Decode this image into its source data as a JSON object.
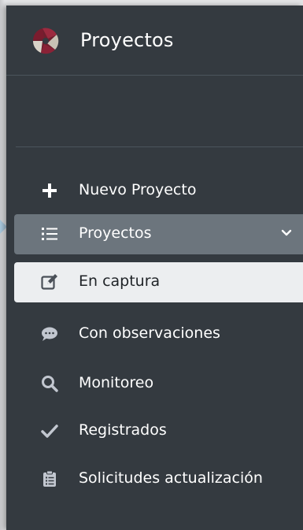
{
  "brand": {
    "title": "Proyectos",
    "logo_icon": "camera-shutter-logo"
  },
  "nav": {
    "items": [
      {
        "label": "Nuevo Proyecto",
        "icon": "plus-icon"
      },
      {
        "label": "Proyectos",
        "icon": "list-icon",
        "expanded": true
      },
      {
        "label": "En captura",
        "icon": "edit-icon",
        "active": true
      },
      {
        "label": "Con observaciones",
        "icon": "comment-icon"
      },
      {
        "label": "Monitoreo",
        "icon": "search-icon"
      },
      {
        "label": "Registrados",
        "icon": "check-icon"
      },
      {
        "label": "Solicitudes actualización",
        "icon": "clipboard-icon"
      }
    ]
  },
  "colors": {
    "sidebar_bg": "#343a40",
    "open_header_bg": "#6c757d",
    "active_bg": "#eceef0",
    "icon_muted": "#c2c7d0"
  }
}
